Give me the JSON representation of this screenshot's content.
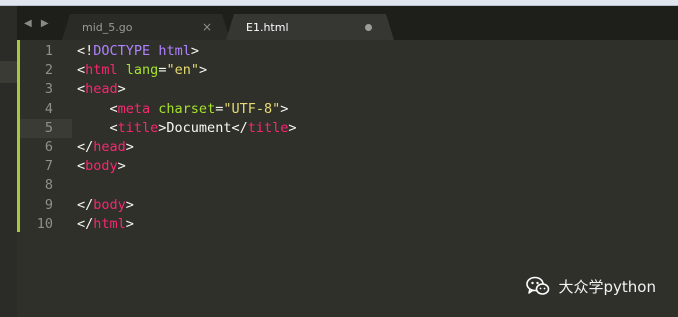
{
  "tabs": [
    {
      "label": "mid_5.go",
      "state": "inactive",
      "indicator": "close-icon",
      "close_glyph": "×"
    },
    {
      "label": "E1.html",
      "state": "active",
      "indicator": "unsaved-dot-icon"
    }
  ],
  "nav_arrows": "◀ ▶",
  "editor": {
    "current_line": 5,
    "lines": [
      {
        "no": "1",
        "parts": [
          [
            "pun",
            "<!"
          ],
          [
            "doct",
            "DOCTYPE"
          ],
          [
            "pun",
            " "
          ],
          [
            "kw",
            "html"
          ],
          [
            "pun",
            ">"
          ]
        ]
      },
      {
        "no": "2",
        "parts": [
          [
            "pun",
            "<"
          ],
          [
            "tag",
            "html"
          ],
          [
            "pun",
            " "
          ],
          [
            "attr",
            "lang"
          ],
          [
            "pun",
            "="
          ],
          [
            "str",
            "\"en\""
          ],
          [
            "pun",
            ">"
          ]
        ]
      },
      {
        "no": "3",
        "parts": [
          [
            "pun",
            "<"
          ],
          [
            "tag",
            "head"
          ],
          [
            "pun",
            ">"
          ]
        ]
      },
      {
        "no": "4",
        "parts": [
          [
            "pun",
            "    <"
          ],
          [
            "tag",
            "meta"
          ],
          [
            "pun",
            " "
          ],
          [
            "attr",
            "charset"
          ],
          [
            "pun",
            "="
          ],
          [
            "str",
            "\"UTF-8\""
          ],
          [
            "pun",
            ">"
          ]
        ]
      },
      {
        "no": "5",
        "parts": [
          [
            "pun",
            "    <"
          ],
          [
            "tag",
            "title"
          ],
          [
            "pun",
            ">"
          ],
          [
            "plain",
            "Document"
          ],
          [
            "pun",
            "</"
          ],
          [
            "tag",
            "title"
          ],
          [
            "pun",
            ">"
          ]
        ]
      },
      {
        "no": "6",
        "parts": [
          [
            "pun",
            "</"
          ],
          [
            "tag",
            "head"
          ],
          [
            "pun",
            ">"
          ]
        ]
      },
      {
        "no": "7",
        "parts": [
          [
            "pun",
            "<"
          ],
          [
            "tag",
            "body"
          ],
          [
            "pun",
            ">"
          ]
        ]
      },
      {
        "no": "8",
        "parts": []
      },
      {
        "no": "9",
        "parts": [
          [
            "pun",
            "</"
          ],
          [
            "tag",
            "body"
          ],
          [
            "pun",
            ">"
          ]
        ]
      },
      {
        "no": "10",
        "parts": [
          [
            "pun",
            "</"
          ],
          [
            "tag",
            "html"
          ],
          [
            "pun",
            ">"
          ]
        ]
      }
    ]
  },
  "watermark": {
    "text": "大众学python",
    "icon": "wechat-icon"
  },
  "colors": {
    "tag": "#f92672",
    "attribute": "#a6e22e",
    "string": "#e6db74",
    "keyword": "#ae81ff",
    "text": "#f8f8f2",
    "line_number": "#8f908a",
    "modified_gutter": "#a6c93b",
    "editor_bg": "#2f302a"
  }
}
